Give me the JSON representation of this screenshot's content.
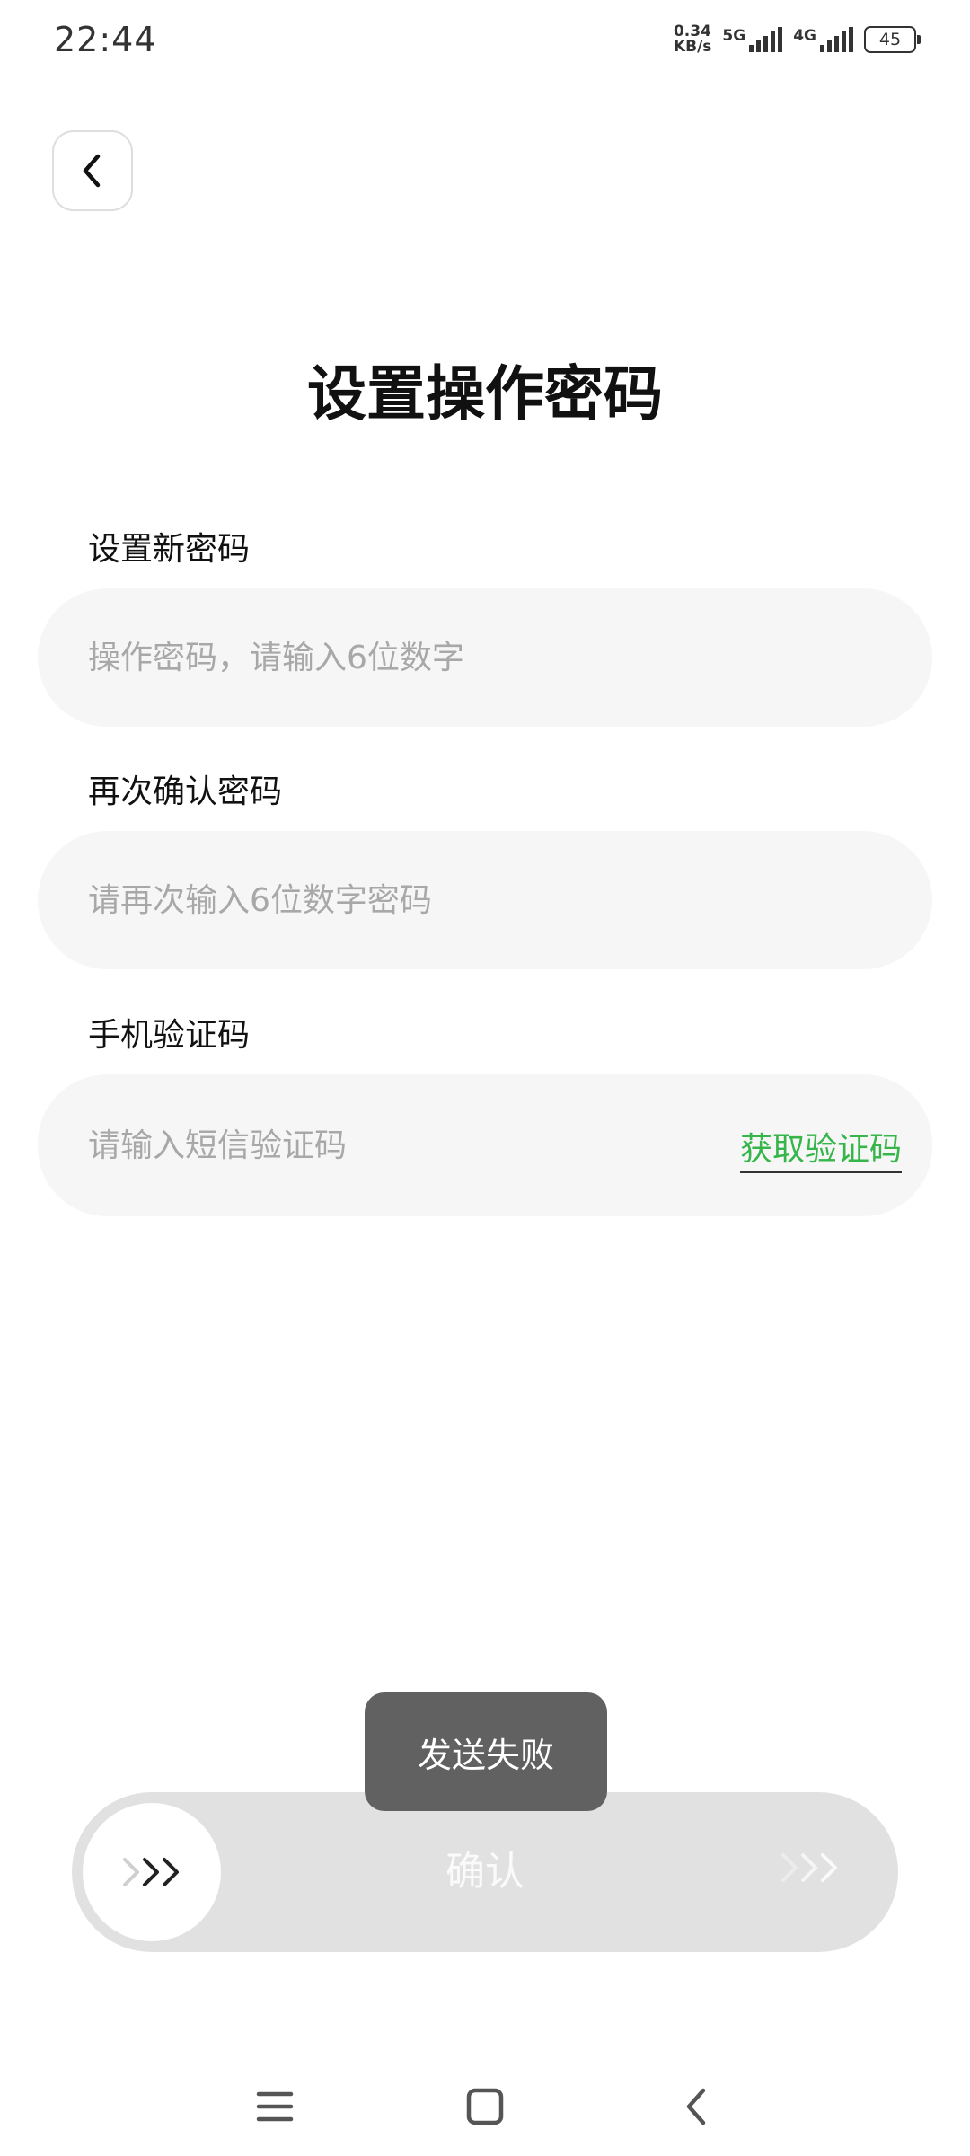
{
  "status_bar": {
    "time": "22:44",
    "speed_value": "0.34",
    "speed_unit": "KB/s",
    "network_1": "5G",
    "network_2": "4G",
    "battery": "45"
  },
  "header": {
    "back_icon": "chevron-left-icon",
    "title": "设置操作密码"
  },
  "form": {
    "new_password": {
      "label": "设置新密码",
      "placeholder": "操作密码，请输入6位数字"
    },
    "confirm_password": {
      "label": "再次确认密码",
      "placeholder": "请再次输入6位数字密码"
    },
    "sms_code": {
      "label": "手机验证码",
      "placeholder": "请输入短信验证码",
      "get_code_label": "获取验证码"
    }
  },
  "toast": {
    "message": "发送失败"
  },
  "confirm_slider": {
    "label": "确认",
    "knob_icon": "triple-chevron-right-icon"
  },
  "colors": {
    "accent_green": "#35b54a",
    "field_bg": "#f6f6f6",
    "slider_bg": "#e1e1e1",
    "toast_bg": "#616161"
  },
  "nav_bar": {
    "menu_icon": "menu-icon",
    "home_icon": "square-home-icon",
    "back_icon": "back-chevron-icon"
  }
}
